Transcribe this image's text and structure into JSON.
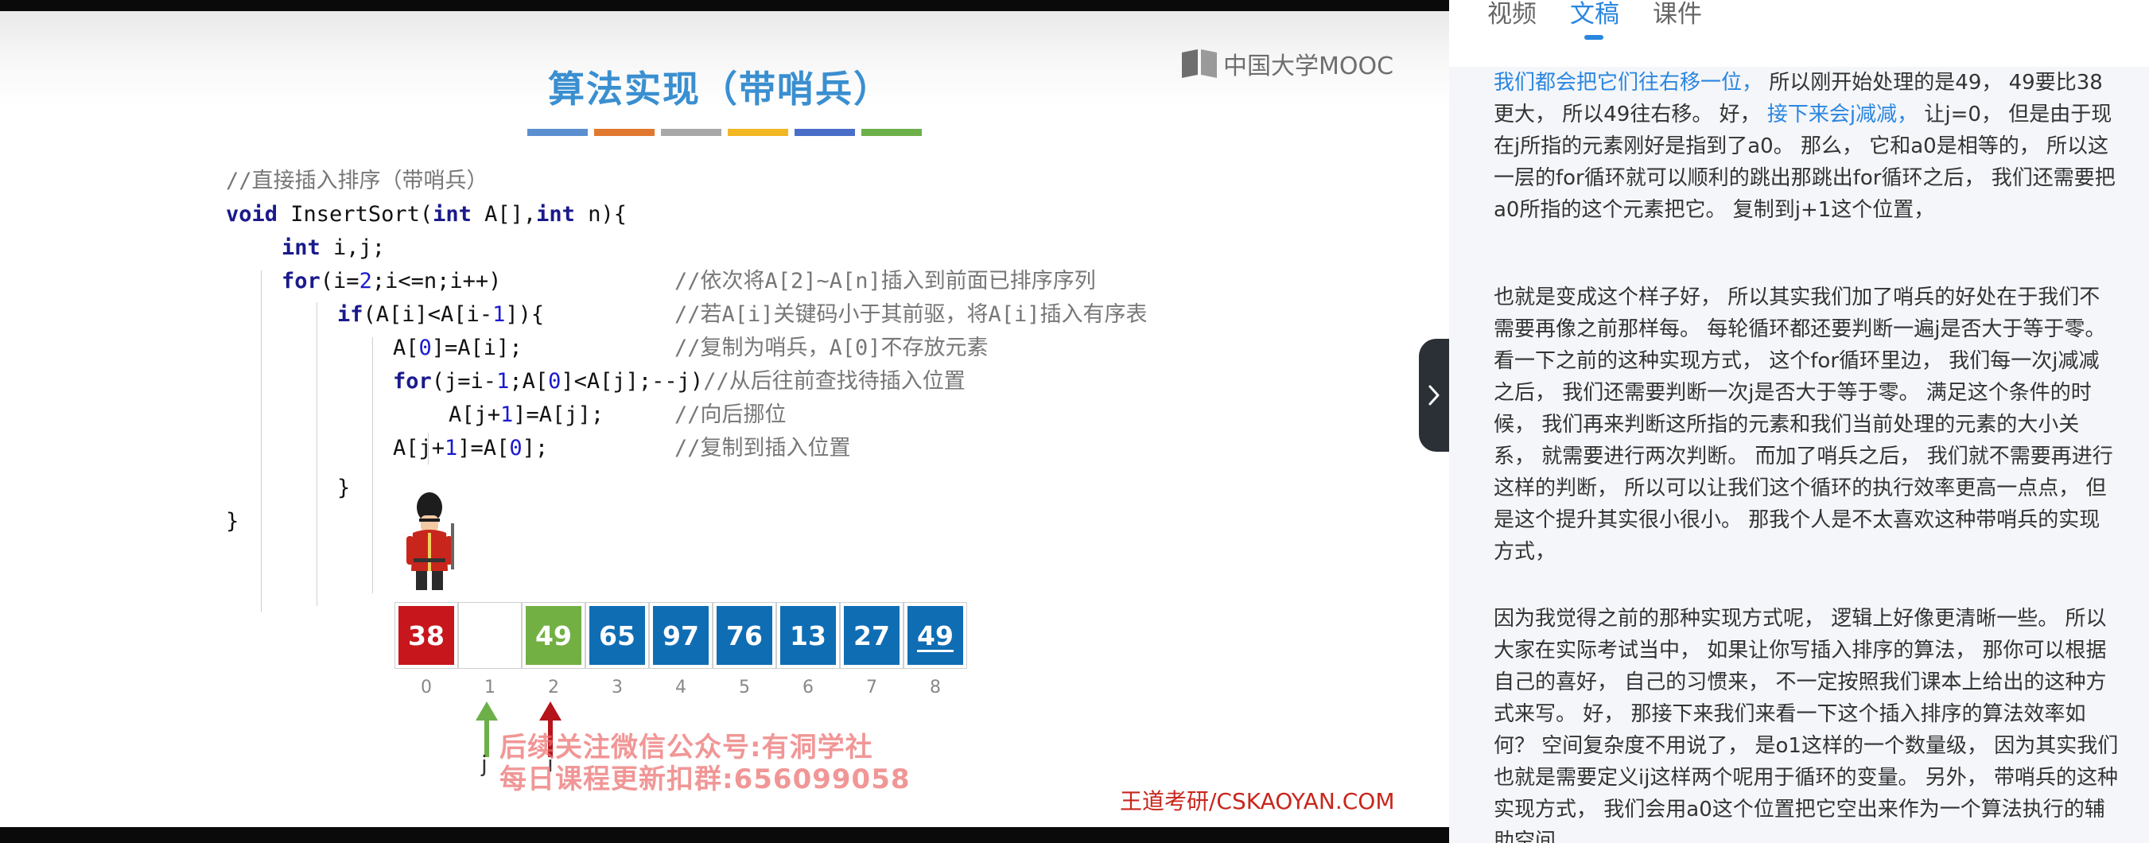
{
  "slide": {
    "title": "算法实现（带哨兵）",
    "logo_text": "中国大学MOOC",
    "stripe_colors": [
      "#5b8fcf",
      "#e0782f",
      "#a8a8a8",
      "#f2b823",
      "#4a6ec8",
      "#6db04a"
    ],
    "code_lines": [
      {
        "indent": 0,
        "parts": [
          {
            "t": "//直接插入排序（带哨兵）",
            "c": "cm"
          }
        ]
      },
      {
        "indent": 0,
        "parts": [
          {
            "t": "void",
            "c": "kw"
          },
          {
            "t": " InsertSort(",
            "c": ""
          },
          {
            "t": "int",
            "c": "kw"
          },
          {
            "t": " A[],",
            "c": ""
          },
          {
            "t": "int",
            "c": "kw"
          },
          {
            "t": " n){",
            "c": ""
          }
        ]
      },
      {
        "indent": 1,
        "parts": [
          {
            "t": "int",
            "c": "kw"
          },
          {
            "t": " i,j;",
            "c": ""
          }
        ]
      },
      {
        "indent": 1,
        "parts": [
          {
            "t": "for",
            "c": "kw"
          },
          {
            "t": "(i=",
            "c": ""
          },
          {
            "t": "2",
            "c": "num"
          },
          {
            "t": ";i<=n;i++)",
            "c": ""
          }
        ],
        "comment": "//依次将A[2]~A[n]插入到前面已排序序列"
      },
      {
        "indent": 2,
        "parts": [
          {
            "t": "if",
            "c": "kw"
          },
          {
            "t": "(A[i]<A[i-",
            "c": ""
          },
          {
            "t": "1",
            "c": "num"
          },
          {
            "t": "]){",
            "c": ""
          }
        ],
        "comment": "//若A[i]关键码小于其前驱，将A[i]插入有序表"
      },
      {
        "indent": 3,
        "parts": [
          {
            "t": "A[",
            "c": ""
          },
          {
            "t": "0",
            "c": "num"
          },
          {
            "t": "]=A[i];",
            "c": ""
          }
        ],
        "comment": "//复制为哨兵，A[0]不存放元素"
      },
      {
        "indent": 3,
        "parts": [
          {
            "t": "for",
            "c": "kw"
          },
          {
            "t": "(j=i-",
            "c": ""
          },
          {
            "t": "1",
            "c": "num"
          },
          {
            "t": ";A[",
            "c": ""
          },
          {
            "t": "0",
            "c": "num"
          },
          {
            "t": "]<A[j];--j)",
            "c": ""
          },
          {
            "t": "//从后往前查找待插入位置",
            "c": "cm"
          }
        ]
      },
      {
        "indent": 4,
        "parts": [
          {
            "t": "A[j+",
            "c": ""
          },
          {
            "t": "1",
            "c": "num"
          },
          {
            "t": "]=A[j];",
            "c": ""
          }
        ],
        "comment": "//向后挪位"
      },
      {
        "indent": 3,
        "parts": [
          {
            "t": "A[j+",
            "c": ""
          },
          {
            "t": "1",
            "c": "num"
          },
          {
            "t": "]=A[",
            "c": ""
          },
          {
            "t": "0",
            "c": "num"
          },
          {
            "t": "];",
            "c": ""
          }
        ],
        "comment": "//复制到插入位置"
      },
      {
        "indent": 2,
        "parts": [
          {
            "t": "}",
            "c": ""
          }
        ]
      },
      {
        "indent": 0,
        "parts": [
          {
            "t": "}",
            "c": ""
          }
        ]
      }
    ],
    "array_cells": [
      {
        "value": "38",
        "color": "#c8161d"
      },
      {
        "value": "",
        "color": "#ffffff"
      },
      {
        "value": "49",
        "color": "#72b043"
      },
      {
        "value": "65",
        "color": "#0f6db4"
      },
      {
        "value": "97",
        "color": "#0f6db4"
      },
      {
        "value": "76",
        "color": "#0f6db4"
      },
      {
        "value": "13",
        "color": "#0f6db4"
      },
      {
        "value": "27",
        "color": "#0f6db4"
      },
      {
        "value": "49",
        "color": "#0f6db4",
        "underline": true
      }
    ],
    "indices": [
      "0",
      "1",
      "2",
      "3",
      "4",
      "5",
      "6",
      "7",
      "8"
    ],
    "pointers": [
      {
        "label": "j",
        "color": "#6db04a"
      },
      {
        "label": "i",
        "color": "#b5141a"
      }
    ],
    "watermark_lines": [
      "后续关注微信公众号:有洞学社",
      "每日课程更新扣群:656099058"
    ],
    "footer_brand": "王道考研/CSKAOYAN.COM"
  },
  "panel": {
    "tabs": [
      "视频",
      "文稿",
      "课件"
    ],
    "active_tab": 1,
    "paragraphs": [
      [
        {
          "text": "我们都会把它们往右移一位，",
          "hl": true
        },
        {
          "text": " 所以刚开始处理的是49， 49要比38更大， 所以49往右移。 好， ",
          "hl": false
        },
        {
          "text": "接下来会j减减，",
          "hl": true
        },
        {
          "text": " 让j=0， 但是由于现在j所指的元素刚好是指到了a0。 那么， 它和a0是相等的， 所以这一层的for循环就可以顺利的跳出那跳出for循环之后， 我们还需要把a0所指的这个元素把它。 复制到j+1这个位置，",
          "hl": false
        }
      ],
      [
        {
          "text": "也就是变成这个样子好， 所以其实我们加了哨兵的好处在于我们不需要再像之前那样每。 每轮循环都还要判断一遍j是否大于等于零。 看一下之前的这种实现方式， 这个for循环里边， 我们每一次j减减之后， 我们还需要判断一次j是否大于等于零。 满足这个条件的时候， 我们再来判断这所指的元素和我们当前处理的元素的大小关系， 就需要进行两次判断。 而加了哨兵之后， 我们就不需要再进行这样的判断， 所以可以让我们这个循环的执行效率更高一点点， 但是这个提升其实很小很小。 那我个人是不太喜欢这种带哨兵的实现方式，",
          "hl": false
        }
      ],
      [
        {
          "text": "因为我觉得之前的那种实现方式呢， 逻辑上好像更清晰一些。 所以大家在实际考试当中， 如果让你写插入排序的算法， 那你可以根据自己的喜好， 自己的习惯来， 不一定按照我们课本上给出的这种方式来写。 好， 那接下来我们来看一下这个插入排序的算法效率如何？ 空间复杂度不用说了， 是o1这样的一个数量级， 因为其实我们也就是需要定义ij这样两个呢用于循环的变量。 另外， 带哨兵的这种实现方式， 我们会用a0这个位置把它空出来作为一个算法执行的辅助空间",
          "hl": false
        }
      ]
    ]
  }
}
